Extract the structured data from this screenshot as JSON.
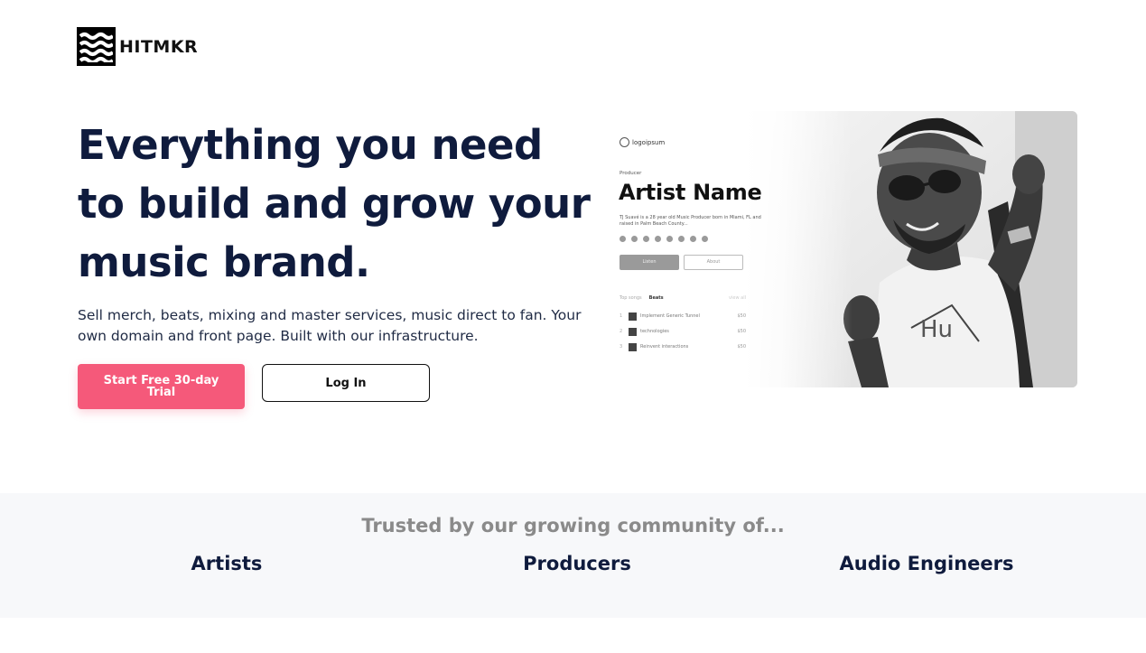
{
  "brand": {
    "name": "HITMKR",
    "accent": "#f5597a",
    "navy": "#0f1b3d"
  },
  "hero": {
    "title": "Everything you need to build and grow your music brand.",
    "subtitle": "Sell merch, beats, mixing and master services, music direct to fan. Your own domain and front page. Built with our infrastructure.",
    "primary_cta": "Start Free 30-day Trial",
    "secondary_cta": "Log In"
  },
  "preview": {
    "logo_text": "logoipsum",
    "role": "Producer",
    "artist_name": "Artist Name",
    "bio": "TJ Suavé is a 28 year old Music Producer born in Miami, FL and raised in Palm Beach County...",
    "social_icons": [
      "spotify-icon",
      "youtube-icon",
      "twitter-icon",
      "instagram-icon",
      "facebook-icon",
      "apple-icon",
      "soundcloud-icon",
      "link-icon"
    ],
    "listen_label": "Listen",
    "about_label": "About",
    "tabs": {
      "first": "Top songs",
      "active": "Beats",
      "right": "view all"
    },
    "tracks": [
      {
        "num": "1",
        "title": "Implement Generic Tunnel",
        "price": "$50"
      },
      {
        "num": "2",
        "title": "technologies",
        "price": "$50"
      },
      {
        "num": "3",
        "title": "Reinvent interactions",
        "price": "$50"
      }
    ]
  },
  "trusted": {
    "heading": "Trusted by our growing community of...",
    "audiences": [
      "Artists",
      "Producers",
      "Audio Engineers"
    ]
  }
}
